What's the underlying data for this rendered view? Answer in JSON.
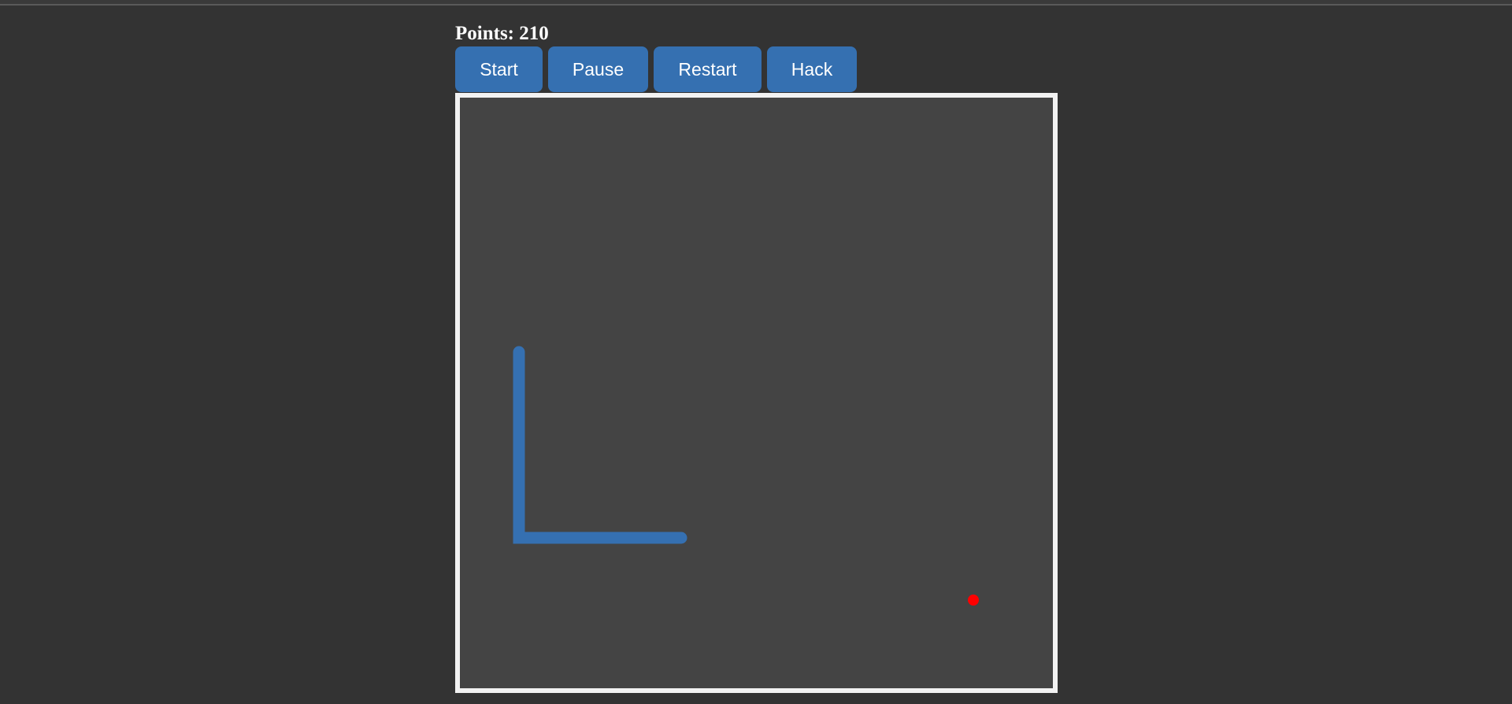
{
  "score": {
    "label": "Points: 210"
  },
  "controls": {
    "start_label": "Start",
    "pause_label": "Pause",
    "restart_label": "Restart",
    "hack_label": "Hack"
  },
  "colors": {
    "page_background": "#333333",
    "board_background": "#444444",
    "board_border": "#f2f2f2",
    "snake": "#3570b1",
    "food": "#ff0000",
    "button": "#3570b1"
  }
}
